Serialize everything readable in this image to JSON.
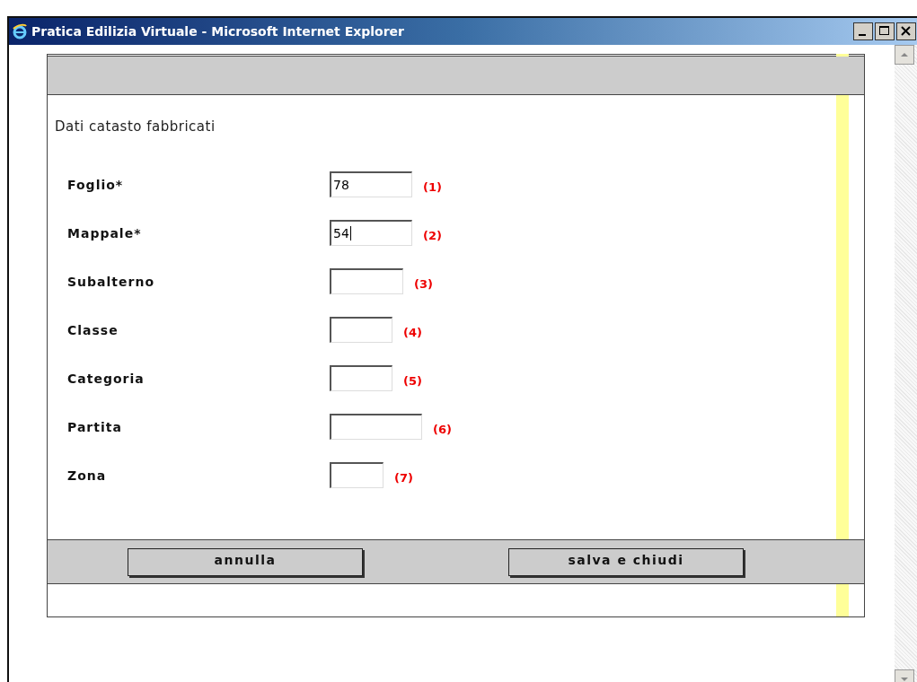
{
  "window": {
    "title": "Pratica Edilizia Virtuale - Microsoft Internet Explorer"
  },
  "form": {
    "title": "Dati catasto fabbricati",
    "fields": [
      {
        "label": "Foglio*",
        "value": "78",
        "note": "(1)",
        "focused": false
      },
      {
        "label": "Mappale*",
        "value": "54",
        "note": "(2)",
        "focused": true
      },
      {
        "label": "Subalterno",
        "note": "(3)",
        "focused": false
      },
      {
        "label": "Classe",
        "note": "(4)",
        "focused": false
      },
      {
        "label": "Categoria",
        "note": "(5)",
        "focused": false
      },
      {
        "label": "Partita",
        "note": "(6)",
        "focused": false
      },
      {
        "label": "Zona",
        "note": "(7)",
        "focused": false
      }
    ],
    "buttons": [
      "annulla",
      "salva e chiudi"
    ]
  }
}
